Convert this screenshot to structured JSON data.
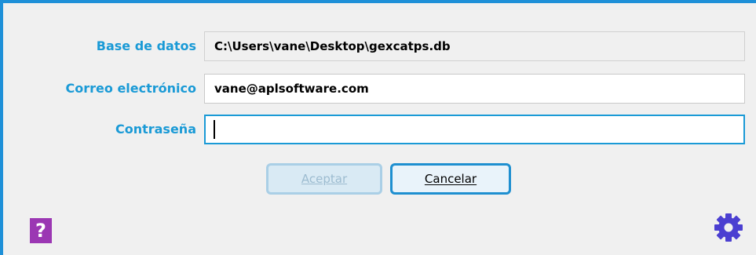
{
  "form": {
    "database": {
      "label": "Base de datos",
      "value": "C:\\Users\\vane\\Desktop\\gexcatps.db"
    },
    "email": {
      "label": "Correo electrónico",
      "value": "vane@aplsoftware.com"
    },
    "password": {
      "label": "Contraseña",
      "value": ""
    }
  },
  "buttons": {
    "accept_label": "Aceptar",
    "cancel_label": "Cancelar"
  },
  "icons": {
    "help": {
      "name": "help-icon",
      "glyph": "?",
      "color": "#9b37b3"
    },
    "settings": {
      "name": "gear-icon",
      "color": "#4b3fd1"
    }
  },
  "colors": {
    "accent": "#1a9ad6",
    "frame": "#1e90d8"
  }
}
